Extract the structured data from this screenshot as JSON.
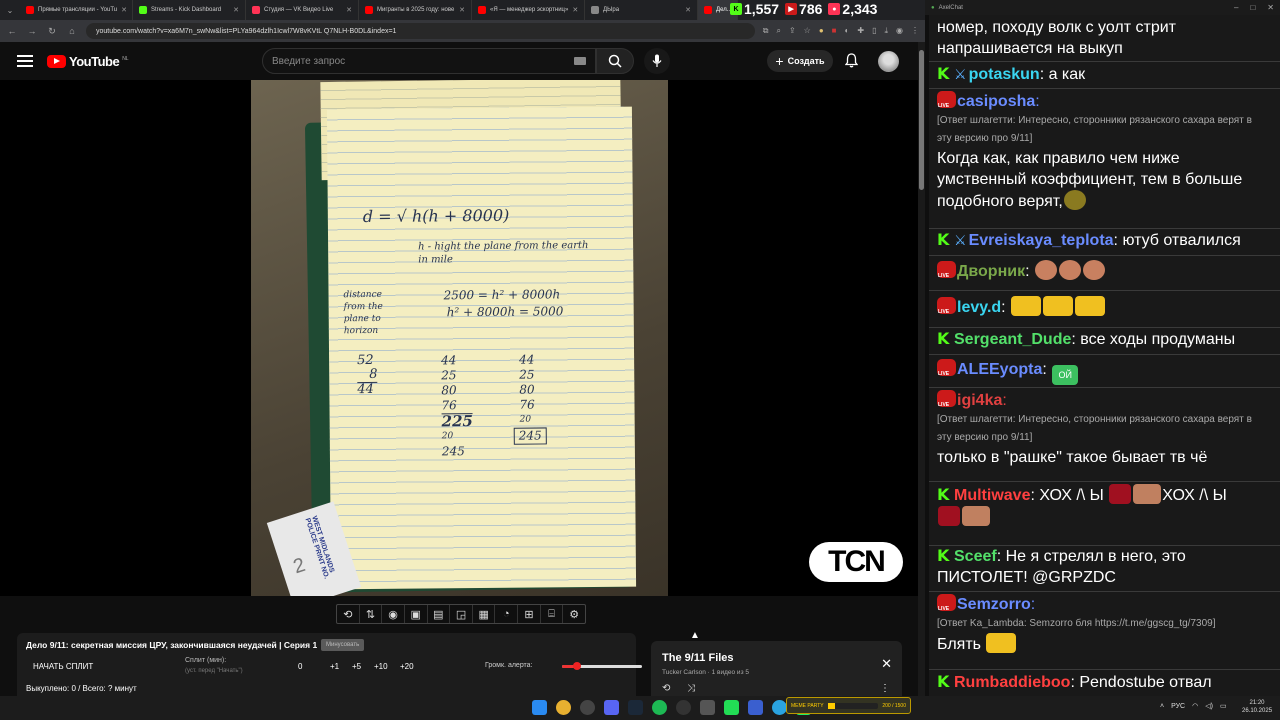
{
  "browser": {
    "tabs": [
      {
        "label": "Прямые трансляции - YouTu",
        "color": "#ff0000"
      },
      {
        "label": "Streams - Kick Dashboard",
        "color": "#53fc18"
      },
      {
        "label": "Студия — VK Видео Live",
        "color": "#ff3355"
      },
      {
        "label": "Мигранты в 2025 году: нове",
        "color": "#ff0000"
      },
      {
        "label": "«Я — менеджер эскортниц»",
        "color": "#ff0000"
      },
      {
        "label": "ДЫра",
        "color": "#888888"
      },
      {
        "label": "Дел...",
        "color": "#ff0000"
      }
    ],
    "url": "youtube.com/watch?v=xa6M7n_swNw&list=PLYa964dzlh1Icwl7W8vKVtL Q7NLH-B0DL&index=1"
  },
  "youtube": {
    "logo_text": "YouTube",
    "region": "NL",
    "search_placeholder": "Введите запрос",
    "create_label": "Создать"
  },
  "video": {
    "watermark": "TCN",
    "notepad": {
      "formula": "d = √ h(h + 8000)",
      "note_h": "h - hight the plane from the earth in mile",
      "left_label": "distance from the plane to horizon",
      "eq1": "2500 = h² + 8000h",
      "eq2": "h² + 8000h = 5000",
      "col1": [
        "52",
        "8",
        "44"
      ],
      "col2": [
        "44",
        "25",
        "80",
        "76",
        "225",
        "20",
        "245"
      ],
      "col3": [
        "44",
        "25",
        "80",
        "76",
        "20",
        "245"
      ],
      "tag_text": "WEST MIDLANDS POLICE PRINT NO.",
      "tag_num": "2"
    }
  },
  "toolbar_icons": [
    "loop-icon",
    "sort-icon",
    "audio-icon",
    "screenshot-icon",
    "cinema-icon",
    "pip-icon",
    "frame-icon",
    "speed-icon",
    "add-icon",
    "camera-icon",
    "settings-icon"
  ],
  "split_panel": {
    "title": "Дело 9/11: секретная миссия ЦРУ, закончившаяся неудачей | Серия 1",
    "badge": "Минусовать",
    "start": "НАЧАТЬ СПЛИТ",
    "split_label": "Сплит (мин):",
    "split_sub": "(уст. перед \"Начать\")",
    "value": "0",
    "steps": [
      "+1",
      "+5",
      "+10",
      "+20"
    ],
    "volume_label": "Громк. алерта:",
    "volume": 0.18,
    "stats": "Выкуплено: 0 / Всего: ? минут"
  },
  "playlist": {
    "title": "The 9/11 Files",
    "subtitle": "Tucker Carlson · 1 видео из 5"
  },
  "counters": [
    {
      "icon": "kick-icon",
      "value": "1,557",
      "color": "#53fc18"
    },
    {
      "icon": "youtube-live-icon",
      "value": "786",
      "color": "#cc1a1a"
    },
    {
      "icon": "vk-live-icon",
      "value": "2,343",
      "color": "#ff3355"
    }
  ],
  "chat_app": {
    "title": "AxelChat"
  },
  "chat": [
    {
      "platform": "",
      "nick": "",
      "color": "",
      "text": "номер, походу волк с уолт стрит напрашивается на выкуп"
    },
    {
      "platform": "kick",
      "mod": true,
      "nick": "potaskun",
      "color": "#3ad5f0",
      "text": "а как"
    },
    {
      "platform": "youtube",
      "nick": "casiposha",
      "color": "#6a8cff",
      "reply": "[Ответ шлагетти: Интересно, сторонники рязанского сахара верят в эту версию про 9/11]",
      "text": "Когда как, как правило чем ниже умственный коэффициент, тем в больше подобного верят,"
    },
    {
      "platform": "kick",
      "mod": true,
      "nick": "Evreiskaya_teplota",
      "color": "#6a8cff",
      "text": "ютуб отвалился"
    },
    {
      "platform": "youtube",
      "nick": "Дворник",
      "color": "#7aa84a",
      "text": ""
    },
    {
      "platform": "youtube",
      "nick": "levy.d",
      "color": "#3ad5f0",
      "text": ""
    },
    {
      "platform": "kick",
      "nick": "Sergeant_Dude",
      "color": "#53e06a",
      "text": "все ходы продуманы"
    },
    {
      "platform": "youtube",
      "nick": "ALEEyopta",
      "color": "#6a8cff",
      "text": ""
    },
    {
      "platform": "youtube",
      "nick": "igi4ka",
      "color": "#e04040",
      "reply": "[Ответ шлагетти: Интересно, сторонники рязанского сахара верят в эту версию про 9/11]",
      "text": "только в \"рашке\" такое бывает тв чё"
    },
    {
      "platform": "kick",
      "nick": "Multiwave",
      "color": "#ff4040",
      "text": "ХОХ /\\ Ы"
    },
    {
      "platform": "kick",
      "nick": "Sceef",
      "color": "#53e06a",
      "text": "Не я стрелял в него, это ПИСТОЛЕТ! @GRPZDC"
    },
    {
      "platform": "youtube",
      "nick": "Semzorro",
      "color": "#6a8cff",
      "reply": "[Ответ Ka_Lambda: Semzorro бля  https://t.me/ggscg_tg/7309]",
      "text": "Блять"
    },
    {
      "platform": "kick",
      "nick": "Rumbaddieboo",
      "color": "#ff4040",
      "text": "Pendostube отвал"
    }
  ],
  "emote_labels": {
    "ali": "ОЙ",
    "multi_repeat": "ХОХ /\\ Ы"
  },
  "meme_party": {
    "label": "MEME PARTY",
    "progress": "200 / 1500",
    "fraction": 0.14
  },
  "taskbar": {
    "lang": "РУС",
    "time": "21:20",
    "date": "26.10.2025"
  }
}
